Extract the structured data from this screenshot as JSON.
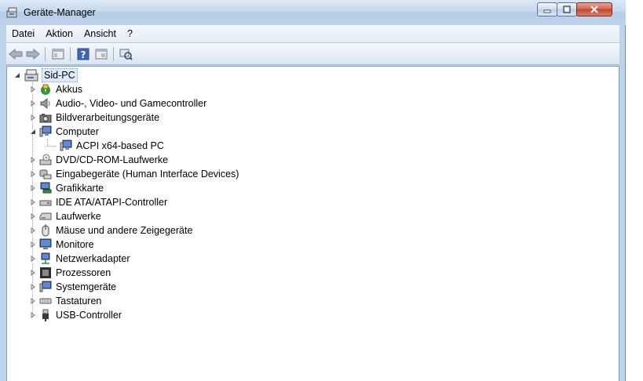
{
  "window": {
    "title": "Geräte-Manager"
  },
  "menu": [
    "Datei",
    "Aktion",
    "Ansicht",
    "?"
  ],
  "toolbar": [
    "back-arrow-icon",
    "forward-arrow-icon",
    "properties-icon",
    "help-icon",
    "console-tree-icon",
    "scan-hardware-icon"
  ],
  "tree": {
    "root": "Sid-PC",
    "categories": [
      {
        "label": "Akkus",
        "icon": "battery-icon",
        "expanded": false
      },
      {
        "label": "Audio-, Video- und Gamecontroller",
        "icon": "speaker-icon",
        "expanded": false
      },
      {
        "label": "Bildverarbeitungsgeräte",
        "icon": "camera-icon",
        "expanded": false
      },
      {
        "label": "Computer",
        "icon": "computer-icon",
        "expanded": true,
        "children": [
          "ACPI x64-based PC"
        ]
      },
      {
        "label": "DVD/CD-ROM-Laufwerke",
        "icon": "dvd-drive-icon",
        "expanded": false
      },
      {
        "label": "Eingabegeräte (Human Interface Devices)",
        "icon": "hid-icon",
        "expanded": false
      },
      {
        "label": "Grafikkarte",
        "icon": "display-adapter-icon",
        "expanded": false
      },
      {
        "label": "IDE ATA/ATAPI-Controller",
        "icon": "ide-controller-icon",
        "expanded": false
      },
      {
        "label": "Laufwerke",
        "icon": "disk-drive-icon",
        "expanded": false
      },
      {
        "label": "Mäuse und andere Zeigegeräte",
        "icon": "mouse-icon",
        "expanded": false
      },
      {
        "label": "Monitore",
        "icon": "monitor-icon",
        "expanded": false
      },
      {
        "label": "Netzwerkadapter",
        "icon": "network-adapter-icon",
        "expanded": false
      },
      {
        "label": "Prozessoren",
        "icon": "processor-icon",
        "expanded": false
      },
      {
        "label": "Systemgeräte",
        "icon": "system-devices-icon",
        "expanded": false
      },
      {
        "label": "Tastaturen",
        "icon": "keyboard-icon",
        "expanded": false
      },
      {
        "label": "USB-Controller",
        "icon": "usb-icon",
        "expanded": false
      }
    ]
  }
}
